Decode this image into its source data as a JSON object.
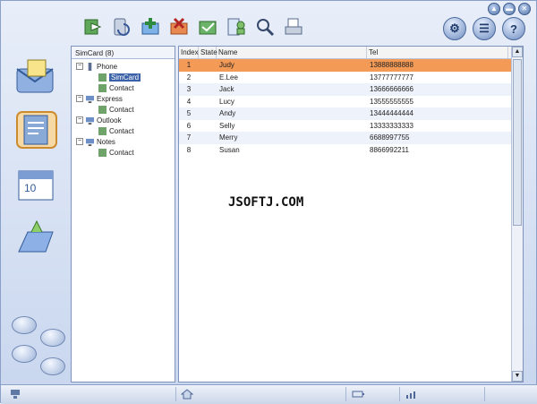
{
  "window": {
    "controls": [
      "▲",
      "▬",
      "✕"
    ]
  },
  "toolbar": {
    "icons": [
      "import-icon",
      "sync-icon",
      "add-icon",
      "delete-icon",
      "export-icon",
      "contacts-icon",
      "find-icon",
      "print-icon"
    ],
    "right_icons": [
      "settings-icon",
      "notes-icon",
      "help-icon"
    ],
    "right_labels": [
      "⚙",
      "☰",
      "?"
    ]
  },
  "leftnav": {
    "items": [
      "messages-icon",
      "phonebook-icon",
      "calendar-icon",
      "files-icon"
    ],
    "small_items": [
      "tool-1-icon",
      "tool-2-icon",
      "tool-3-icon",
      "tool-4-icon"
    ]
  },
  "tree": {
    "title": "SimCard (8)",
    "nodes": [
      {
        "label": "Phone",
        "expand": "−",
        "icon": "phone-icon"
      },
      {
        "label": "SimCard",
        "icon": "contact-icon",
        "selected": true
      },
      {
        "label": "Contact",
        "icon": "contact-icon"
      },
      {
        "label": "Express",
        "expand": "−",
        "icon": "computer-icon"
      },
      {
        "label": "Contact",
        "icon": "contact-icon"
      },
      {
        "label": "Outlook",
        "expand": "−",
        "icon": "computer-icon"
      },
      {
        "label": "Contact",
        "icon": "contact-icon"
      },
      {
        "label": "Notes",
        "expand": "−",
        "icon": "computer-icon"
      },
      {
        "label": "Contact",
        "icon": "contact-icon"
      }
    ]
  },
  "grid": {
    "headers": {
      "index": "Index",
      "state": "State",
      "name": "Name",
      "tel": "Tel"
    },
    "rows": [
      {
        "index": "1",
        "name": "Judy",
        "tel": "13888888888"
      },
      {
        "index": "2",
        "name": "E.Lee",
        "tel": "13777777777"
      },
      {
        "index": "3",
        "name": "Jack",
        "tel": "13666666666"
      },
      {
        "index": "4",
        "name": "Lucy",
        "tel": "13555555555"
      },
      {
        "index": "5",
        "name": "Andy",
        "tel": "13444444444"
      },
      {
        "index": "6",
        "name": "Selly",
        "tel": "13333333333"
      },
      {
        "index": "7",
        "name": "Merry",
        "tel": "6688997755"
      },
      {
        "index": "8",
        "name": "Susan",
        "tel": "8866992211"
      }
    ]
  },
  "watermark": "JSOFTJ.COM",
  "colors": {
    "selected_row": "#f39a56",
    "tree_selected": "#3b61a8"
  }
}
